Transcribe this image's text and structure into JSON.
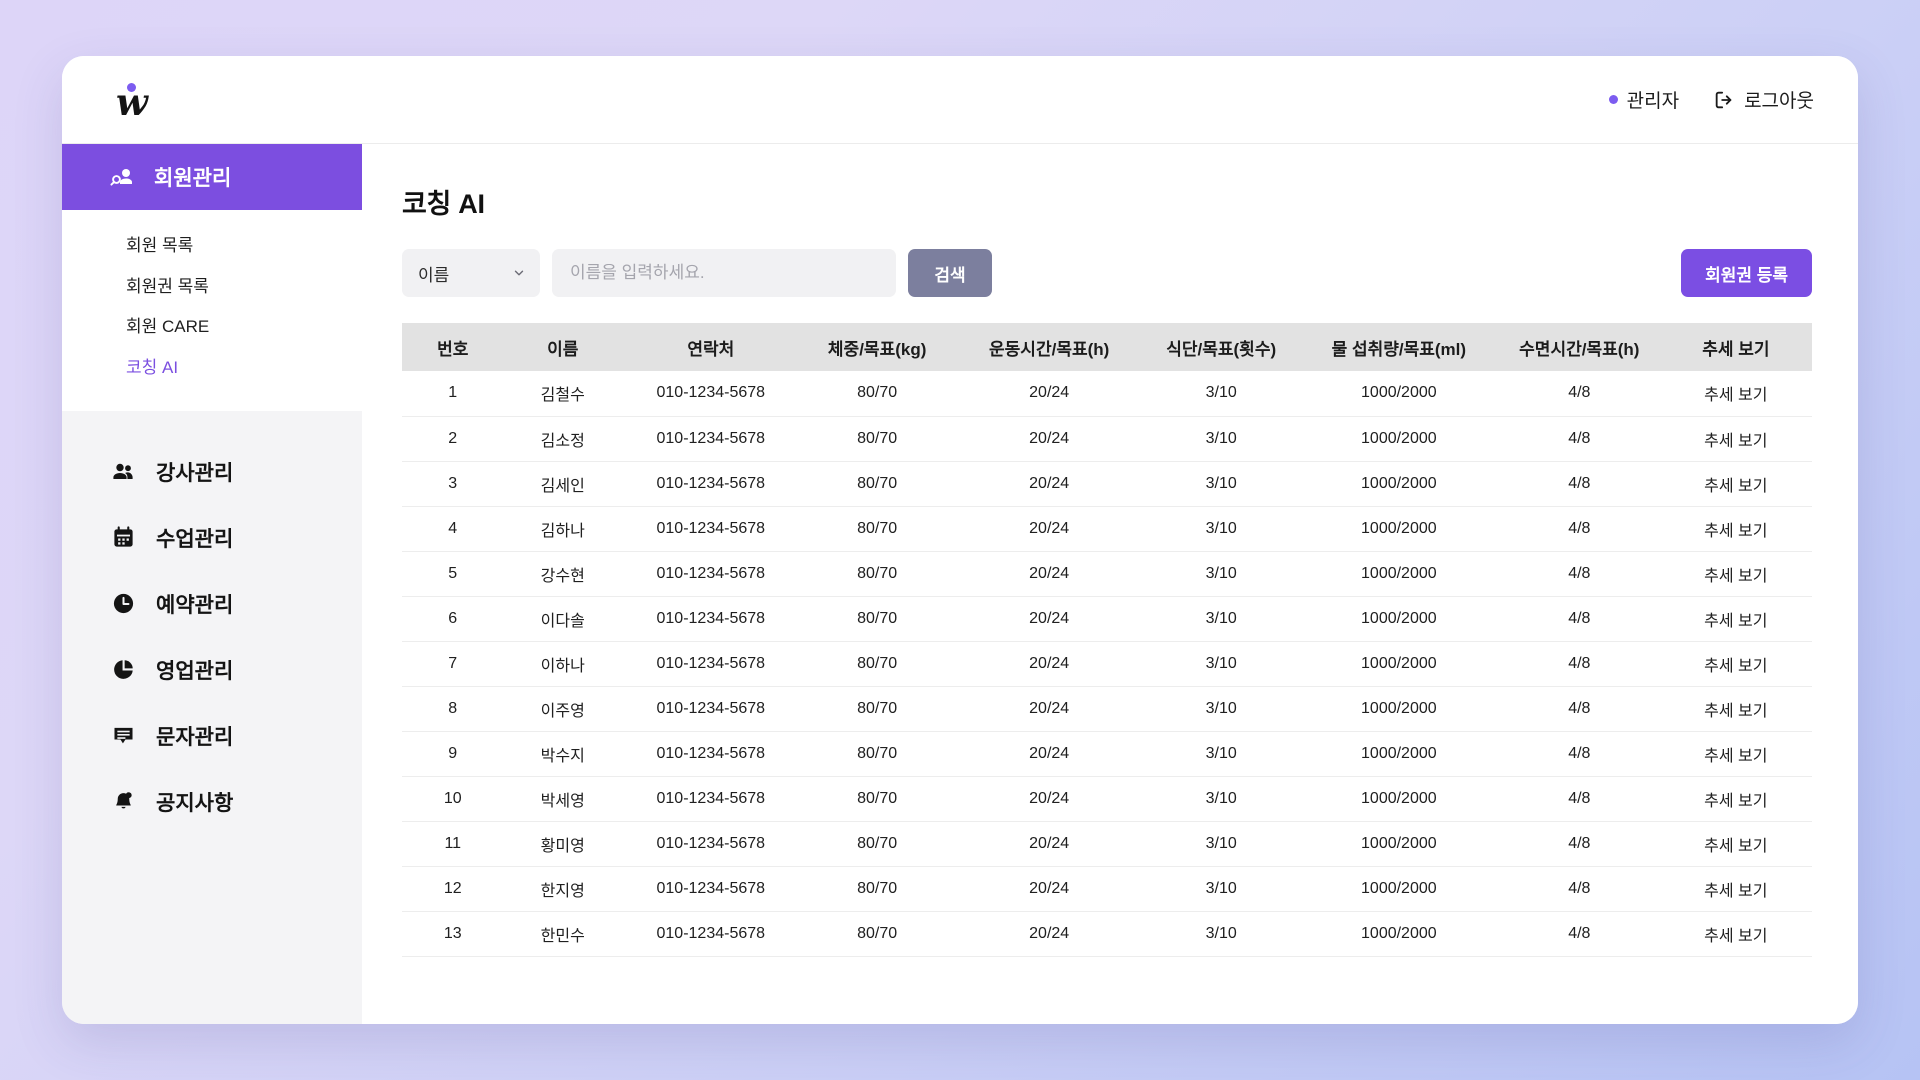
{
  "brand": {
    "logo_letter": "w",
    "logo_icon": "cursive-w-logo"
  },
  "topbar": {
    "admin_label": "관리자",
    "logout_label": "로그아웃"
  },
  "sidebar": {
    "group": {
      "label": "회원관리",
      "icon": "member-search-icon",
      "items": [
        {
          "label": "회원 목록",
          "active": false
        },
        {
          "label": "회원권 목록",
          "active": false
        },
        {
          "label": "회원 CARE",
          "active": false
        },
        {
          "label": "코칭 AI",
          "active": true
        }
      ]
    },
    "items": [
      {
        "label": "강사관리",
        "icon": "people-icon"
      },
      {
        "label": "수업관리",
        "icon": "calendar-icon"
      },
      {
        "label": "예약관리",
        "icon": "clock-icon"
      },
      {
        "label": "영업관리",
        "icon": "pie-chart-icon"
      },
      {
        "label": "문자관리",
        "icon": "message-icon"
      },
      {
        "label": "공지사항",
        "icon": "bell-icon"
      }
    ]
  },
  "main": {
    "page_title": "코칭 AI",
    "toolbar": {
      "filter_selected": "이름",
      "filter_options": [
        "이름"
      ],
      "search_placeholder": "이름을 입력하세요.",
      "search_value": "",
      "search_button": "검색",
      "register_button": "회원권 등록"
    },
    "table": {
      "columns": [
        "번호",
        "이름",
        "연락처",
        "체중/목표(kg)",
        "운동시간/목표(h)",
        "식단/목표(횟수)",
        "물 섭취량/목표(ml)",
        "수면시간/목표(h)",
        "추세 보기"
      ],
      "rows": [
        {
          "no": "1",
          "name": "김철수",
          "phone": "010-1234-5678",
          "weight": "80/70",
          "exercise": "20/24",
          "diet": "3/10",
          "water": "1000/2000",
          "sleep": "4/8",
          "trend": "추세 보기"
        },
        {
          "no": "2",
          "name": "김소정",
          "phone": "010-1234-5678",
          "weight": "80/70",
          "exercise": "20/24",
          "diet": "3/10",
          "water": "1000/2000",
          "sleep": "4/8",
          "trend": "추세 보기"
        },
        {
          "no": "3",
          "name": "김세인",
          "phone": "010-1234-5678",
          "weight": "80/70",
          "exercise": "20/24",
          "diet": "3/10",
          "water": "1000/2000",
          "sleep": "4/8",
          "trend": "추세 보기"
        },
        {
          "no": "4",
          "name": "김하나",
          "phone": "010-1234-5678",
          "weight": "80/70",
          "exercise": "20/24",
          "diet": "3/10",
          "water": "1000/2000",
          "sleep": "4/8",
          "trend": "추세 보기"
        },
        {
          "no": "5",
          "name": "강수현",
          "phone": "010-1234-5678",
          "weight": "80/70",
          "exercise": "20/24",
          "diet": "3/10",
          "water": "1000/2000",
          "sleep": "4/8",
          "trend": "추세 보기"
        },
        {
          "no": "6",
          "name": "이다솔",
          "phone": "010-1234-5678",
          "weight": "80/70",
          "exercise": "20/24",
          "diet": "3/10",
          "water": "1000/2000",
          "sleep": "4/8",
          "trend": "추세 보기"
        },
        {
          "no": "7",
          "name": "이하나",
          "phone": "010-1234-5678",
          "weight": "80/70",
          "exercise": "20/24",
          "diet": "3/10",
          "water": "1000/2000",
          "sleep": "4/8",
          "trend": "추세 보기"
        },
        {
          "no": "8",
          "name": "이주영",
          "phone": "010-1234-5678",
          "weight": "80/70",
          "exercise": "20/24",
          "diet": "3/10",
          "water": "1000/2000",
          "sleep": "4/8",
          "trend": "추세 보기"
        },
        {
          "no": "9",
          "name": "박수지",
          "phone": "010-1234-5678",
          "weight": "80/70",
          "exercise": "20/24",
          "diet": "3/10",
          "water": "1000/2000",
          "sleep": "4/8",
          "trend": "추세 보기"
        },
        {
          "no": "10",
          "name": "박세영",
          "phone": "010-1234-5678",
          "weight": "80/70",
          "exercise": "20/24",
          "diet": "3/10",
          "water": "1000/2000",
          "sleep": "4/8",
          "trend": "추세 보기"
        },
        {
          "no": "11",
          "name": "황미영",
          "phone": "010-1234-5678",
          "weight": "80/70",
          "exercise": "20/24",
          "diet": "3/10",
          "water": "1000/2000",
          "sleep": "4/8",
          "trend": "추세 보기"
        },
        {
          "no": "12",
          "name": "한지영",
          "phone": "010-1234-5678",
          "weight": "80/70",
          "exercise": "20/24",
          "diet": "3/10",
          "water": "1000/2000",
          "sleep": "4/8",
          "trend": "추세 보기"
        },
        {
          "no": "13",
          "name": "한민수",
          "phone": "010-1234-5678",
          "weight": "80/70",
          "exercise": "20/24",
          "diet": "3/10",
          "water": "1000/2000",
          "sleep": "4/8",
          "trend": "추세 보기"
        }
      ]
    }
  },
  "colors": {
    "accent_purple": "#7b4ee3",
    "sidebar_active": "#7c4ee0",
    "search_button": "#7c7f9e",
    "table_header": "#e2e2e2",
    "sidebar_bg": "#f4f4f6",
    "bg_gradient_start": "#ddd5f8",
    "bg_gradient_end": "#b6c3f4"
  }
}
